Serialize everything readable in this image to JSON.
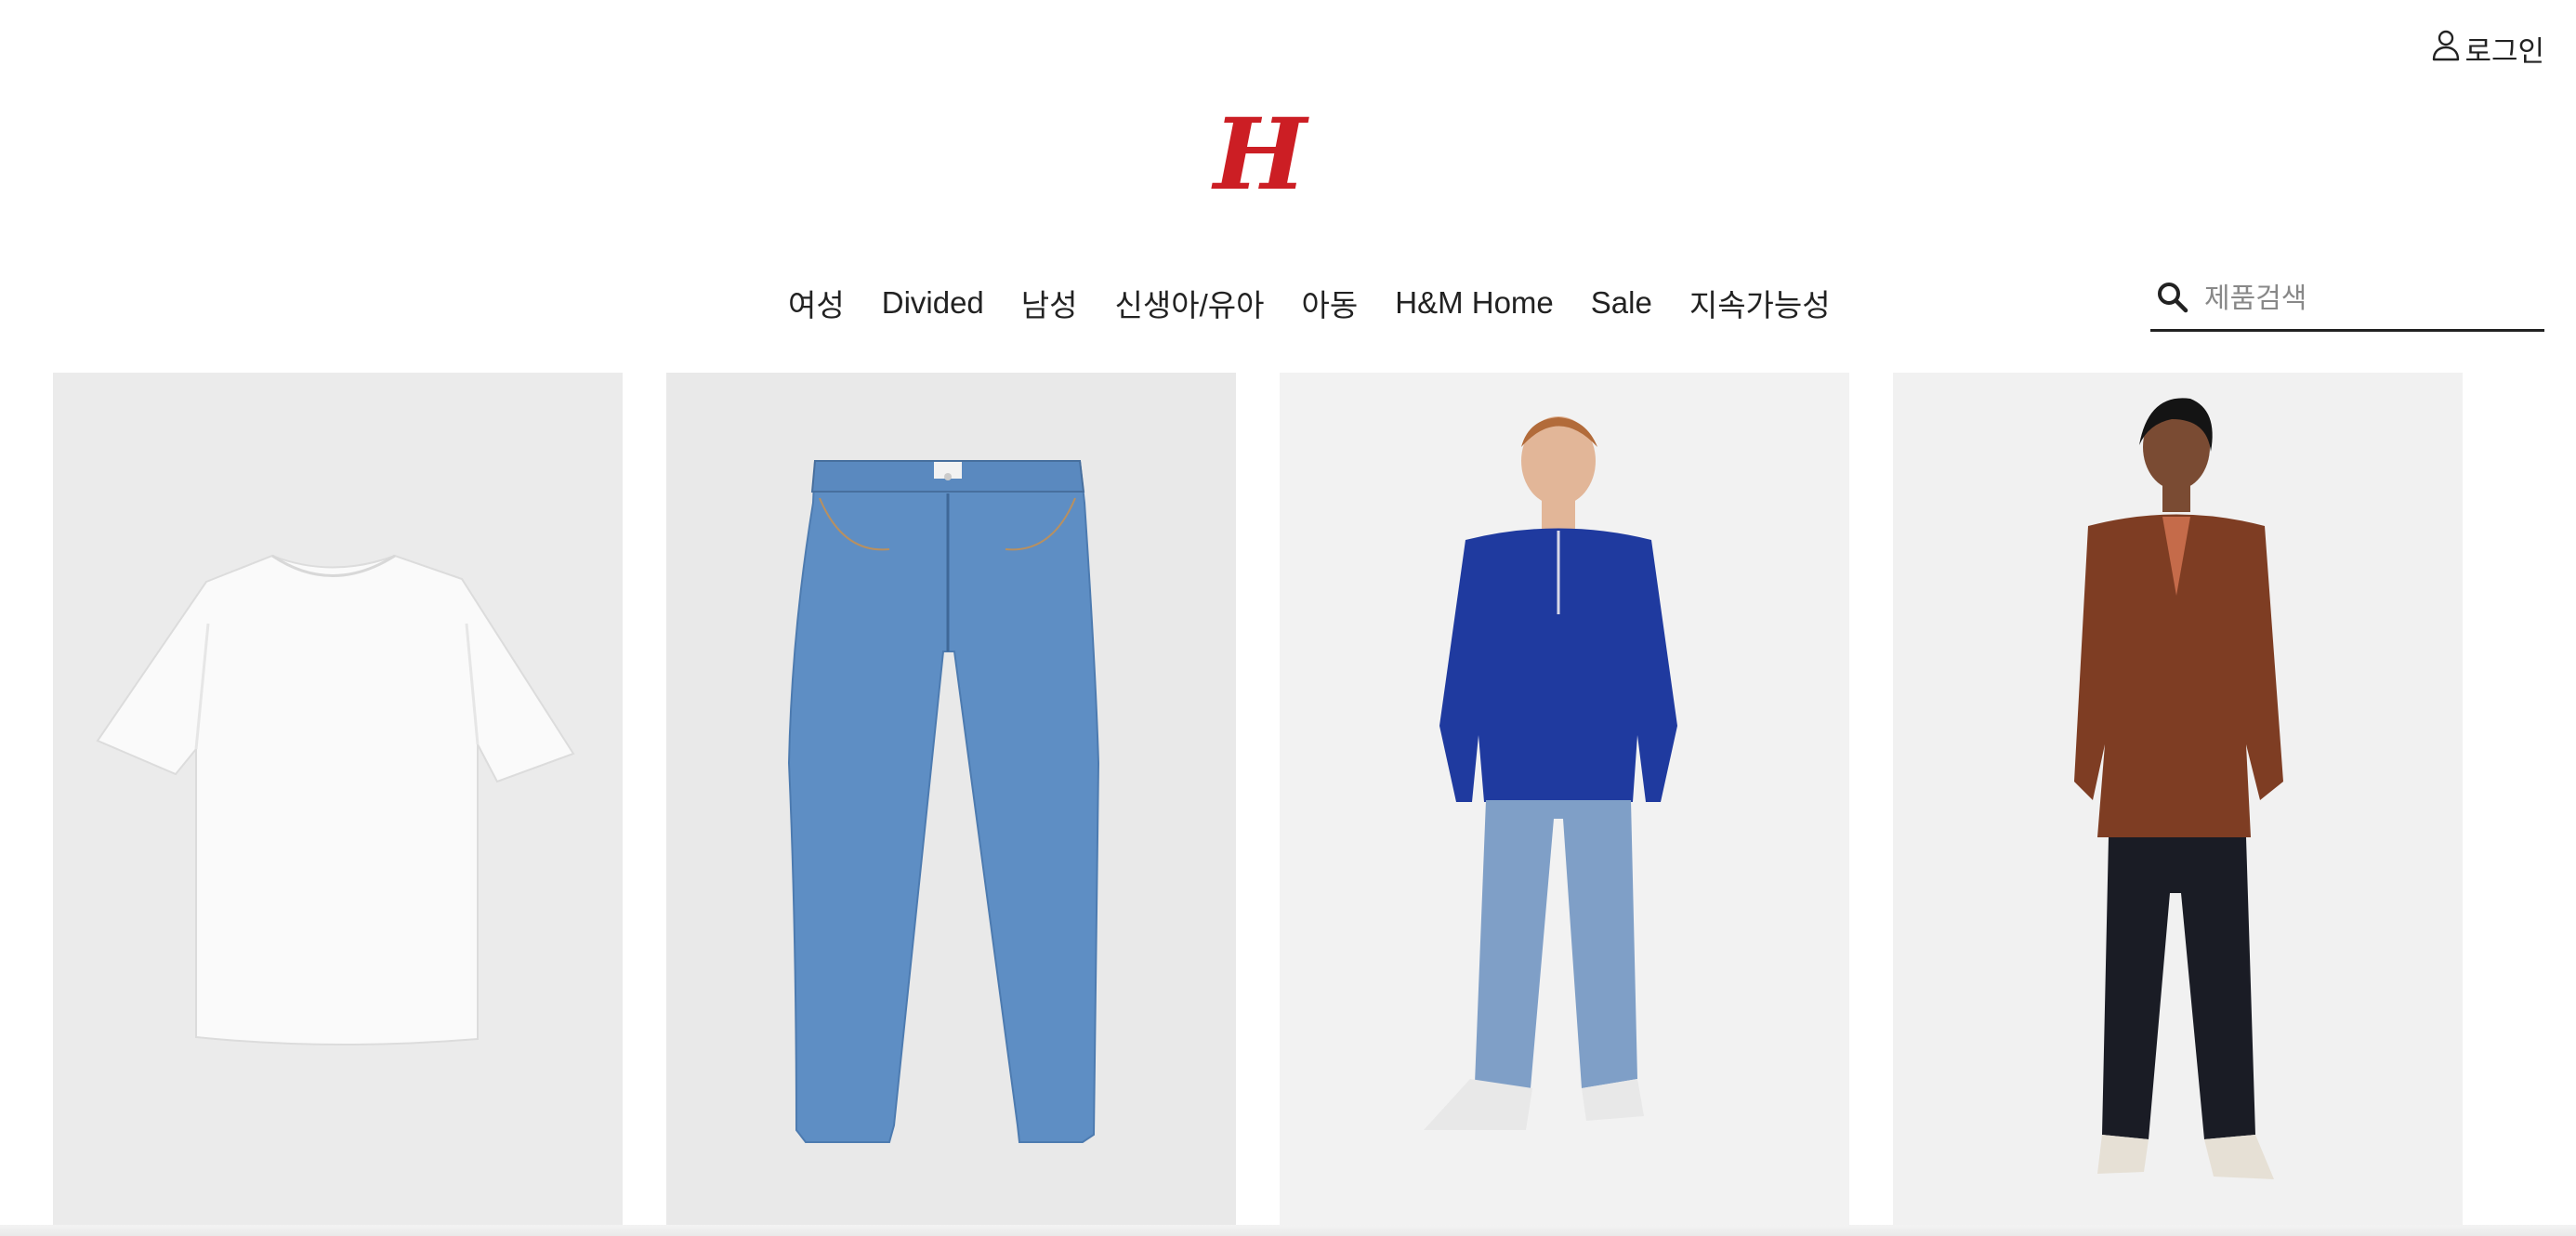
{
  "header": {
    "login_label": "로그인",
    "brand_color": "#cc1e24"
  },
  "nav": {
    "items": [
      {
        "label": "여성"
      },
      {
        "label": "Divided"
      },
      {
        "label": "남성"
      },
      {
        "label": "신생아/유아"
      },
      {
        "label": "아동"
      },
      {
        "label": "H&M Home"
      },
      {
        "label": "Sale"
      },
      {
        "label": "지속가능성"
      }
    ]
  },
  "search": {
    "placeholder": "제품검색",
    "value": ""
  },
  "products": [
    {
      "image": "white-tshirt"
    },
    {
      "image": "blue-jeans"
    },
    {
      "image": "man-blue-half-zip-sweatshirt"
    },
    {
      "image": "man-brown-blazer"
    }
  ]
}
